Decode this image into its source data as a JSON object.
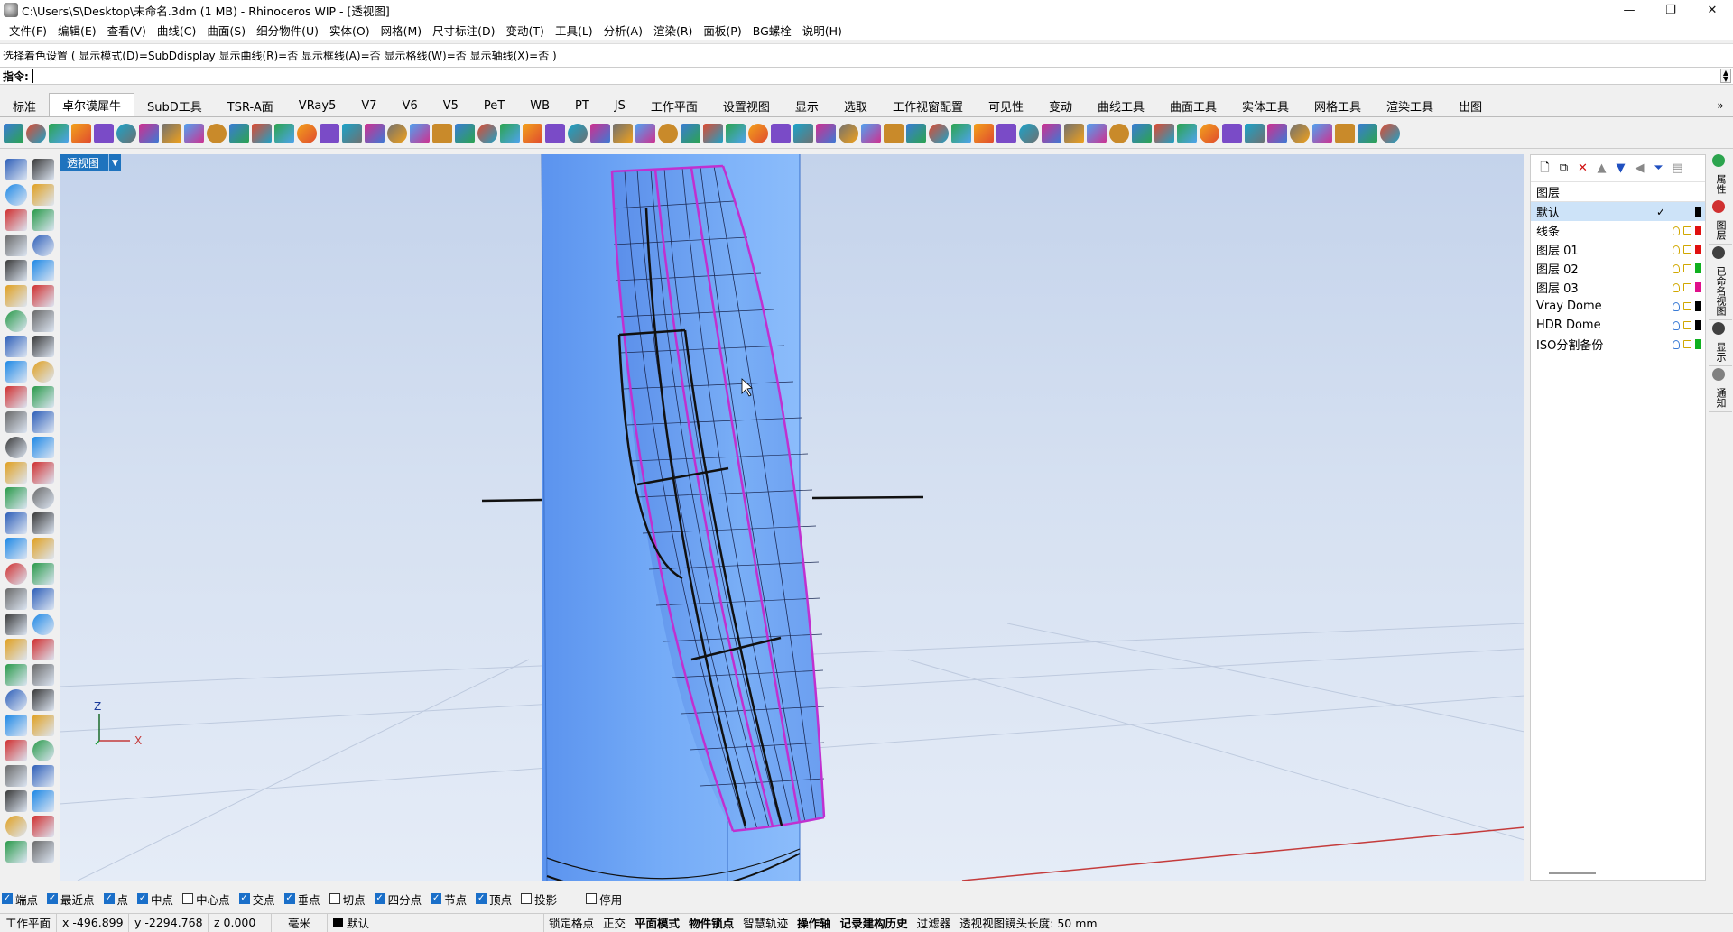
{
  "window": {
    "title": "C:\\Users\\S\\Desktop\\未命名.3dm (1 MB) - Rhinoceros WIP - [透视图]",
    "minimize": "—",
    "maximize": "❐",
    "close": "✕"
  },
  "menu": [
    "文件(F)",
    "编辑(E)",
    "查看(V)",
    "曲线(C)",
    "曲面(S)",
    "细分物件(U)",
    "实体(O)",
    "网格(M)",
    "尺寸标注(D)",
    "变动(T)",
    "工具(L)",
    "分析(A)",
    "渲染(R)",
    "面板(P)",
    "BG螺栓",
    "说明(H)"
  ],
  "command": {
    "history": "选择着色设置 ( 显示模式(D)=SubDdisplay  显示曲线(R)=否  显示框线(A)=否  显示格线(W)=否  显示轴线(X)=否 )",
    "prompt": "指令:",
    "value": ""
  },
  "tabs": [
    "标准",
    "卓尔谟犀牛",
    "SubD工具",
    "TSR-A面",
    "VRay5",
    "V7",
    "V6",
    "V5",
    "PeT",
    "WB",
    "PT",
    "JS",
    "工作平面",
    "设置视图",
    "显示",
    "选取",
    "工作视窗配置",
    "可见性",
    "变动",
    "曲线工具",
    "曲面工具",
    "实体工具",
    "网格工具",
    "渲染工具",
    "出图"
  ],
  "active_tab": "卓尔谟犀牛",
  "tab_more": "»",
  "viewport": {
    "label": "透视图",
    "axis_z": "Z",
    "axis_x": "X",
    "colors": {
      "surface": "#6ea6f5",
      "edge_magenta": "#c030d0",
      "edge_black": "#111111"
    }
  },
  "layers": {
    "header": "图层",
    "rows": [
      {
        "name": "默认",
        "color": "#000000",
        "current": true
      },
      {
        "name": "线条",
        "color": "#e01010"
      },
      {
        "name": "图层 01",
        "color": "#e01010"
      },
      {
        "name": "图层 02",
        "color": "#10b020"
      },
      {
        "name": "图层 03",
        "color": "#e0108a"
      },
      {
        "name": "Vray Dome",
        "color": "#000000"
      },
      {
        "name": "HDR Dome",
        "color": "#000000"
      },
      {
        "name": "ISO分割备份",
        "color": "#10b020"
      }
    ],
    "current_mark": "✓"
  },
  "side_tabs": [
    "属性",
    "图层",
    "已命名视图",
    "显示",
    "通知"
  ],
  "osnap": [
    {
      "label": "端点",
      "on": true
    },
    {
      "label": "最近点",
      "on": true
    },
    {
      "label": "点",
      "on": true
    },
    {
      "label": "中点",
      "on": true
    },
    {
      "label": "中心点",
      "on": false
    },
    {
      "label": "交点",
      "on": true
    },
    {
      "label": "垂点",
      "on": true
    },
    {
      "label": "切点",
      "on": false
    },
    {
      "label": "四分点",
      "on": true
    },
    {
      "label": "节点",
      "on": true
    },
    {
      "label": "顶点",
      "on": true
    },
    {
      "label": "投影",
      "on": false
    },
    {
      "label": "停用",
      "on": false
    }
  ],
  "status": {
    "cplane": "工作平面",
    "x": "x -496.899",
    "y": "y -2294.768",
    "z": "z 0.000",
    "unit": "毫米",
    "layer": "默认",
    "buttons": [
      "锁定格点",
      "正交",
      "平面模式",
      "物件锁点",
      "智慧轨迹",
      "操作轴",
      "记录建构历史",
      "过滤器"
    ],
    "bold_buttons": [
      "平面模式",
      "物件锁点",
      "操作轴",
      "记录建构历史"
    ],
    "lens": "透视视图镜头长度: 50 mm"
  }
}
